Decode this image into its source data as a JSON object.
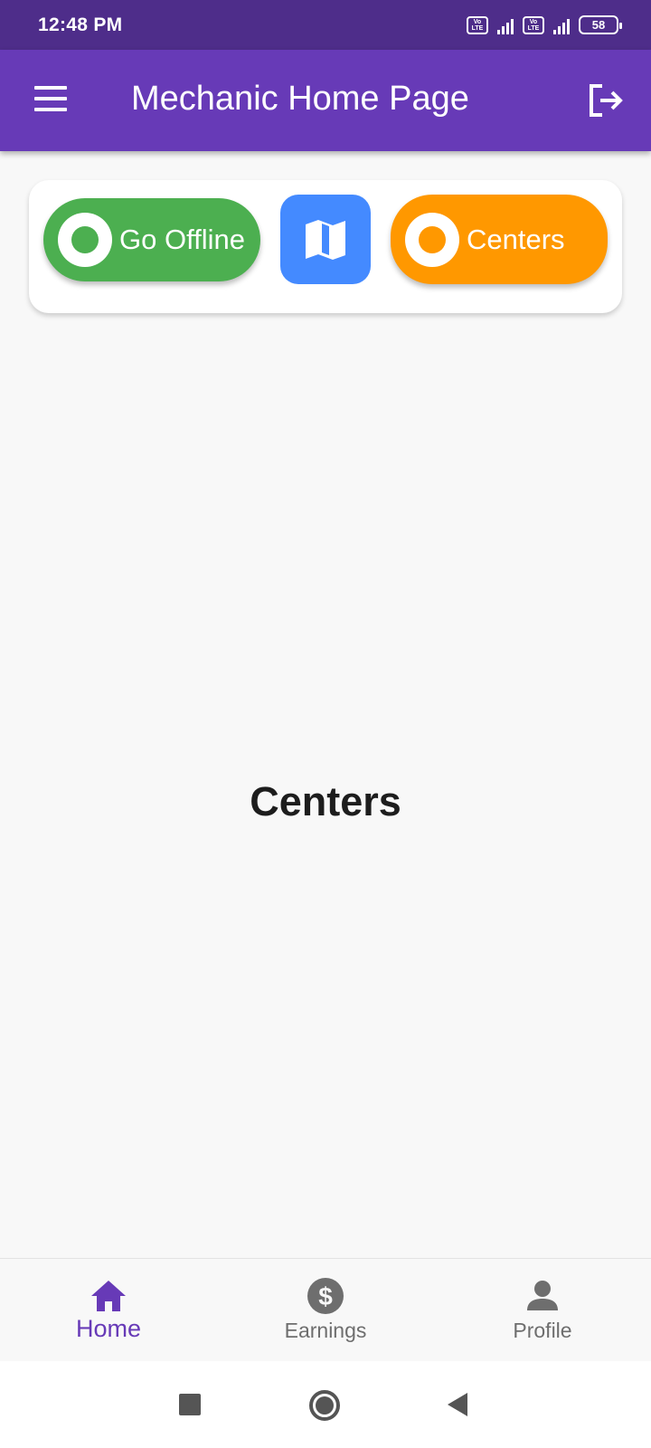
{
  "status_bar": {
    "time": "12:48 PM",
    "volte_label": "Vo LTE",
    "battery_level": "58"
  },
  "app_bar": {
    "title": "Mechanic Home Page",
    "menu_icon": "hamburger-menu-icon",
    "logout_icon": "logout-icon"
  },
  "actions": {
    "offline_label": "Go Offline",
    "map_icon": "map-icon",
    "centers_label": "Centers"
  },
  "content": {
    "heading": "Centers"
  },
  "bottom_nav": {
    "items": [
      {
        "label": "Home",
        "icon": "home-icon",
        "active": true
      },
      {
        "label": "Earnings",
        "icon": "dollar-icon",
        "active": false
      },
      {
        "label": "Profile",
        "icon": "person-icon",
        "active": false
      }
    ]
  },
  "colors": {
    "status_bar": "#4e2d8a",
    "app_bar": "#673ab7",
    "offline_green": "#4caf50",
    "map_blue": "#448aff",
    "centers_orange": "#ff9800",
    "nav_active": "#673ab7",
    "nav_inactive": "#6e6e6e"
  }
}
